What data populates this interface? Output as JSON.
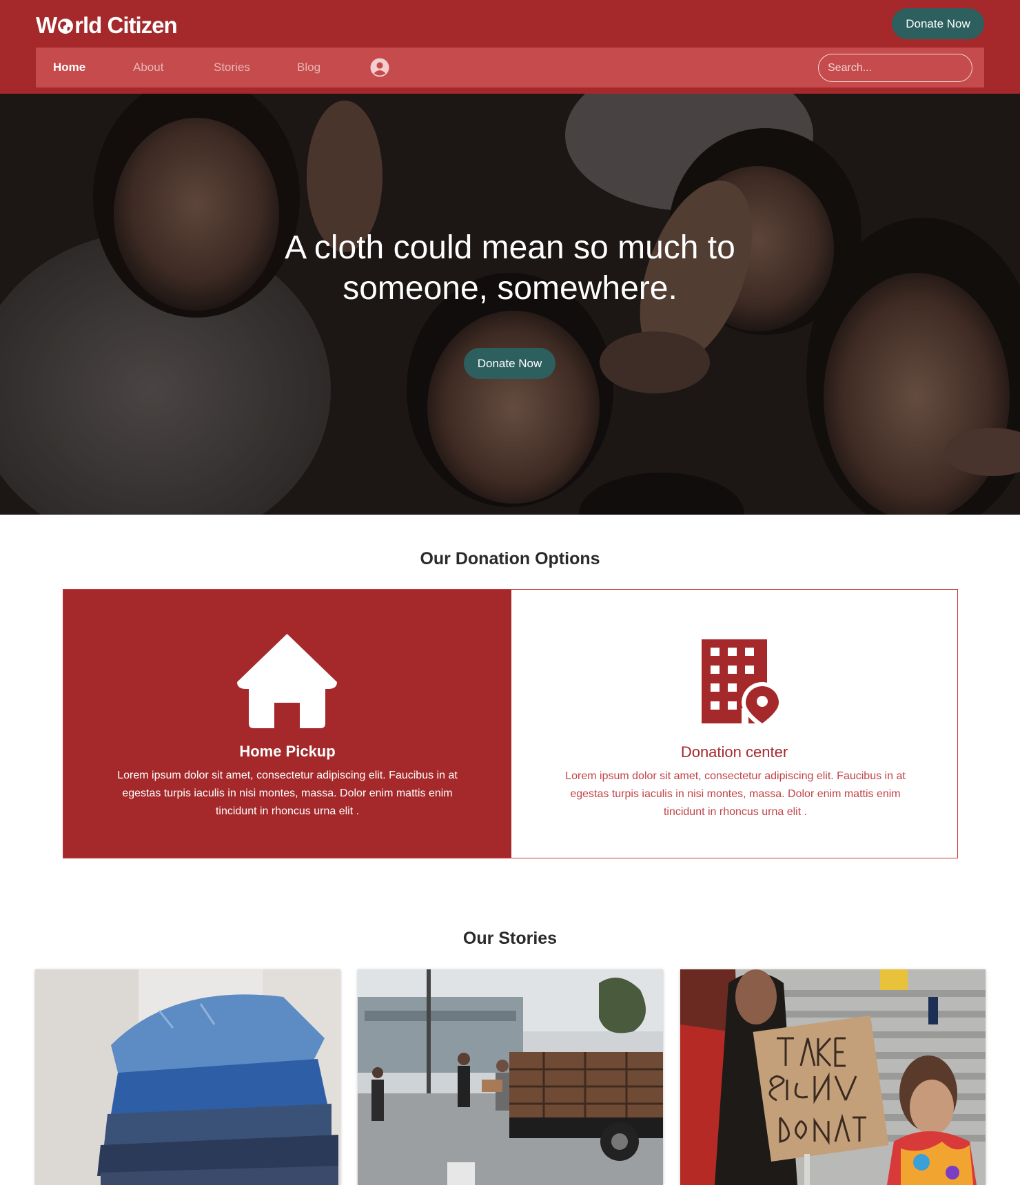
{
  "header": {
    "logo_text_before": "W",
    "logo_text_after": "rld Citizen",
    "donate_label": "Donate Now"
  },
  "nav": {
    "items": [
      {
        "label": "Home",
        "active": true
      },
      {
        "label": "About",
        "active": false
      },
      {
        "label": "Stories",
        "active": false
      },
      {
        "label": "Blog",
        "active": false
      }
    ],
    "search_placeholder": "Search..."
  },
  "hero": {
    "title_line1": "A cloth could mean so much to",
    "title_line2": "someone, somewhere.",
    "donate_label": "Donate Now"
  },
  "donation_options": {
    "heading": "Our Donation Options",
    "options": [
      {
        "title": "Home Pickup",
        "text": "Lorem ipsum dolor sit amet, consectetur adipiscing elit. Faucibus in at egestas turpis iaculis in nisi montes, massa. Dolor enim mattis enim tincidunt in rhoncus urna elit .",
        "icon": "home-icon"
      },
      {
        "title": "Donation center",
        "text": "Lorem ipsum dolor sit amet, consectetur adipiscing elit. Faucibus in at egestas turpis iaculis in nisi montes, massa. Dolor enim mattis enim tincidunt in rhoncus urna elit .",
        "icon": "building-location-icon"
      }
    ]
  },
  "stories": {
    "heading": "Our Stories"
  },
  "colors": {
    "brand_red": "#a5292b",
    "nav_red": "#c64b4c",
    "teal_button": "#2c5f5e"
  }
}
